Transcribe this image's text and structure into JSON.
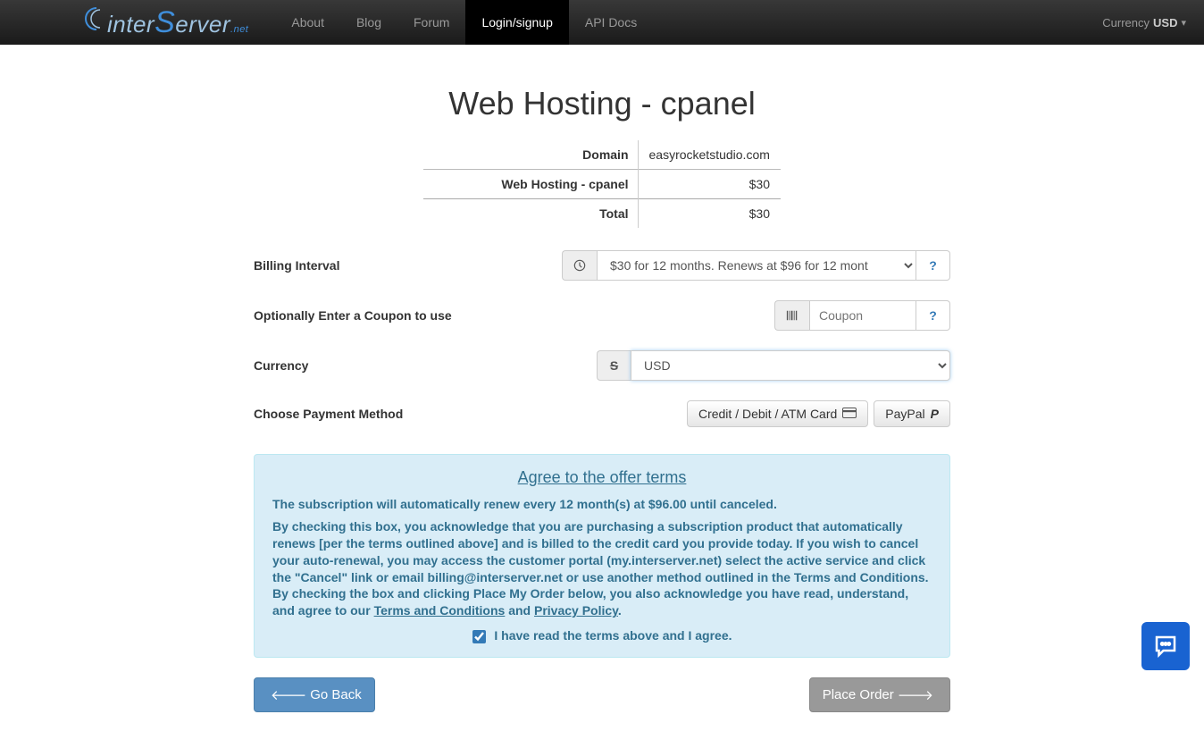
{
  "nav": {
    "brand_inter": "inter",
    "brand_erver": "erver",
    "brand_net": ".net",
    "links": [
      {
        "label": "About",
        "active": false
      },
      {
        "label": "Blog",
        "active": false
      },
      {
        "label": "Forum",
        "active": false
      },
      {
        "label": "Login/signup",
        "active": true
      },
      {
        "label": "API Docs",
        "active": false
      }
    ],
    "currency_label": "Currency",
    "currency_value": "USD"
  },
  "page": {
    "title": "Web Hosting - cpanel"
  },
  "summary": {
    "rows": [
      {
        "label": "Domain",
        "value": "easyrocketstudio.com",
        "price": false
      },
      {
        "label": "Web Hosting - cpanel",
        "value": "$30",
        "price": true
      },
      {
        "label": "Total",
        "value": "$30",
        "price": true
      }
    ]
  },
  "billing": {
    "label": "Billing Interval",
    "selected": "$30 for 12 months. Renews at $96 for 12 mont",
    "help": "?"
  },
  "coupon": {
    "label": "Optionally Enter a Coupon to use",
    "placeholder": "Coupon",
    "help": "?"
  },
  "currency": {
    "label": "Currency",
    "selected": "USD"
  },
  "payment": {
    "label": "Choose Payment Method",
    "card_label": "Credit / Debit / ATM Card",
    "paypal_label": "PayPal"
  },
  "terms": {
    "heading": "Agree to the offer terms",
    "p1": "The subscription will automatically renew every 12 month(s) at $96.00 until canceled.",
    "p2a": "By checking this box, you acknowledge that you are purchasing a subscription product that automatically renews [per the terms outlined above] and is billed to the credit card you provide today. If you wish to cancel your auto-renewal, you may access the customer portal (my.interserver.net) select the active service and click the \"Cancel\" link or email billing@interserver.net or use another method outlined in the Terms and Conditions. By checking the box and clicking Place My Order below, you also acknowledge you have read, understand, and agree to our ",
    "tc": "Terms and Conditions",
    "and": " and ",
    "pp": "Privacy Policy",
    "period": ".",
    "check_label": "I have read the terms above and I agree.",
    "checked": true
  },
  "actions": {
    "back": "Go Back",
    "place": "Place Order"
  }
}
